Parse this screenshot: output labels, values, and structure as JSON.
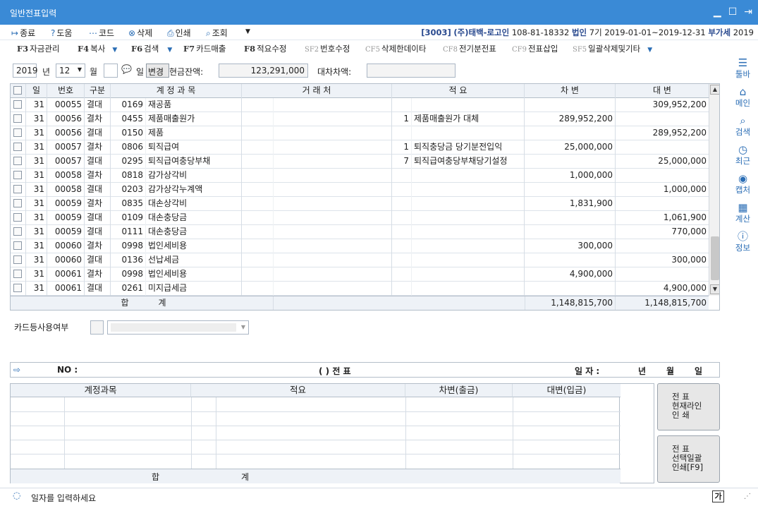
{
  "window": {
    "title": "일반전표입력"
  },
  "toolbar": [
    {
      "icon": "exit-icon",
      "glyph": "↦",
      "label": "종료"
    },
    {
      "icon": "help-icon",
      "glyph": "?",
      "label": "도움"
    },
    {
      "icon": "code-icon",
      "glyph": "⋯",
      "label": "코드"
    },
    {
      "icon": "delete-icon",
      "glyph": "⊗",
      "label": "삭제"
    },
    {
      "icon": "print-icon",
      "glyph": "⎙",
      "label": "인쇄"
    },
    {
      "icon": "search-icon",
      "glyph": "⌕",
      "label": "조회"
    }
  ],
  "company": {
    "code": "[3003]",
    "name": "(주)태백-로고인",
    "regno": "108-81-18332",
    "type": "법인",
    "period": "7기 2019-01-01~2019-12-31",
    "vat": "부가세",
    "year": "2019"
  },
  "fkeys": [
    {
      "key": "F3",
      "label": "자금관리"
    },
    {
      "key": "F4",
      "label": "복사"
    },
    {
      "key": "F6",
      "label": "검색"
    },
    {
      "key": "F7",
      "label": "카드매출"
    },
    {
      "key": "F8",
      "label": "적요수정"
    },
    {
      "key": "SF2",
      "label": "번호수정"
    },
    {
      "key": "CF5",
      "label": "삭제한데이타"
    },
    {
      "key": "CF8",
      "label": "전기분전표"
    },
    {
      "key": "CF9",
      "label": "전표삽입"
    },
    {
      "key": "SF5",
      "label": "일괄삭제및기타"
    }
  ],
  "sidebar": [
    {
      "icon": "menu-icon",
      "glyph": "☰",
      "label": "툴바"
    },
    {
      "icon": "home-icon",
      "glyph": "⌂",
      "label": "메인"
    },
    {
      "icon": "search-icon",
      "glyph": "⌕",
      "label": "검색"
    },
    {
      "icon": "history-icon",
      "glyph": "◷",
      "label": "최근"
    },
    {
      "icon": "camera-icon",
      "glyph": "◉",
      "label": "캡처"
    },
    {
      "icon": "calculator-icon",
      "glyph": "▦",
      "label": "계산"
    },
    {
      "icon": "info-icon",
      "glyph": "ⓘ",
      "label": "정보"
    }
  ],
  "filter": {
    "year": "2019",
    "year_label": "년",
    "month": "12",
    "month_label": "월",
    "day": "",
    "day_label": "일",
    "change_btn": "변경",
    "cash_label": "현금잔액:",
    "cash_value": "123,291,000",
    "diff_label": "대차차액:",
    "diff_value": ""
  },
  "grid": {
    "headers": [
      "일",
      "번호",
      "구분",
      "계 정 과 목",
      "거 래 처",
      "적 요",
      "차 변",
      "대 변"
    ],
    "rows": [
      {
        "day": "31",
        "no": "00055",
        "type": "결대",
        "acct_code": "0169",
        "acct_name": "재공품",
        "partner_code": "",
        "partner": "",
        "memo_code": "",
        "memo": "",
        "debit": "",
        "credit": "309,952,200"
      },
      {
        "day": "31",
        "no": "00056",
        "type": "결차",
        "acct_code": "0455",
        "acct_name": "제품매출원가",
        "partner_code": "",
        "partner": "",
        "memo_code": "1",
        "memo": "제품매출원가 대체",
        "debit": "289,952,200",
        "credit": ""
      },
      {
        "day": "31",
        "no": "00056",
        "type": "결대",
        "acct_code": "0150",
        "acct_name": "제품",
        "partner_code": "",
        "partner": "",
        "memo_code": "",
        "memo": "",
        "debit": "",
        "credit": "289,952,200"
      },
      {
        "day": "31",
        "no": "00057",
        "type": "결차",
        "acct_code": "0806",
        "acct_name": "퇴직급여",
        "partner_code": "",
        "partner": "",
        "memo_code": "1",
        "memo": "퇴직충당금 당기분전입익",
        "debit": "25,000,000",
        "credit": ""
      },
      {
        "day": "31",
        "no": "00057",
        "type": "결대",
        "acct_code": "0295",
        "acct_name": "퇴직급여충당부채",
        "partner_code": "",
        "partner": "",
        "memo_code": "7",
        "memo": "퇴직급여충당부채당기설정",
        "debit": "",
        "credit": "25,000,000"
      },
      {
        "day": "31",
        "no": "00058",
        "type": "결차",
        "acct_code": "0818",
        "acct_name": "감가상각비",
        "partner_code": "",
        "partner": "",
        "memo_code": "",
        "memo": "",
        "debit": "1,000,000",
        "credit": ""
      },
      {
        "day": "31",
        "no": "00058",
        "type": "결대",
        "acct_code": "0203",
        "acct_name": "감가상각누계액",
        "partner_code": "",
        "partner": "",
        "memo_code": "",
        "memo": "",
        "debit": "",
        "credit": "1,000,000"
      },
      {
        "day": "31",
        "no": "00059",
        "type": "결차",
        "acct_code": "0835",
        "acct_name": "대손상각비",
        "partner_code": "",
        "partner": "",
        "memo_code": "",
        "memo": "",
        "debit": "1,831,900",
        "credit": ""
      },
      {
        "day": "31",
        "no": "00059",
        "type": "결대",
        "acct_code": "0109",
        "acct_name": "대손충당금",
        "partner_code": "",
        "partner": "",
        "memo_code": "",
        "memo": "",
        "debit": "",
        "credit": "1,061,900"
      },
      {
        "day": "31",
        "no": "00059",
        "type": "결대",
        "acct_code": "0111",
        "acct_name": "대손충당금",
        "partner_code": "",
        "partner": "",
        "memo_code": "",
        "memo": "",
        "debit": "",
        "credit": "770,000"
      },
      {
        "day": "31",
        "no": "00060",
        "type": "결차",
        "acct_code": "0998",
        "acct_name": "법인세비용",
        "partner_code": "",
        "partner": "",
        "memo_code": "",
        "memo": "",
        "debit": "300,000",
        "credit": ""
      },
      {
        "day": "31",
        "no": "00060",
        "type": "결대",
        "acct_code": "0136",
        "acct_name": "선납세금",
        "partner_code": "",
        "partner": "",
        "memo_code": "",
        "memo": "",
        "debit": "",
        "credit": "300,000"
      },
      {
        "day": "31",
        "no": "00061",
        "type": "결차",
        "acct_code": "0998",
        "acct_name": "법인세비용",
        "partner_code": "",
        "partner": "",
        "memo_code": "",
        "memo": "",
        "debit": "4,900,000",
        "credit": ""
      },
      {
        "day": "31",
        "no": "00061",
        "type": "결대",
        "acct_code": "0261",
        "acct_name": "미지급세금",
        "partner_code": "",
        "partner": "",
        "memo_code": "",
        "memo": "",
        "debit": "",
        "credit": "4,900,000"
      }
    ],
    "sum_label1": "합",
    "sum_label2": "계",
    "sum_debit": "1,148,815,700",
    "sum_credit": "1,148,815,700"
  },
  "card": {
    "label": "카드등사용여부",
    "value": ""
  },
  "voucher_bar": {
    "no_label": "NO :",
    "type_label": "(        ) 전  표",
    "date_label": "일 자 :",
    "y": "년",
    "m": "월",
    "d": "일"
  },
  "detail": {
    "headers": [
      "계정과목",
      "적요",
      "차변(출금)",
      "대변(입금)"
    ],
    "sum_label1": "합",
    "sum_label2": "계"
  },
  "buttons": {
    "print_line": [
      "전    표",
      "현재라인",
      "인    쇄"
    ],
    "print_batch": [
      "전    표",
      "선택일괄",
      "인쇄[F9]"
    ]
  },
  "status": {
    "message": "일자를 입력하세요",
    "ime": "가"
  }
}
